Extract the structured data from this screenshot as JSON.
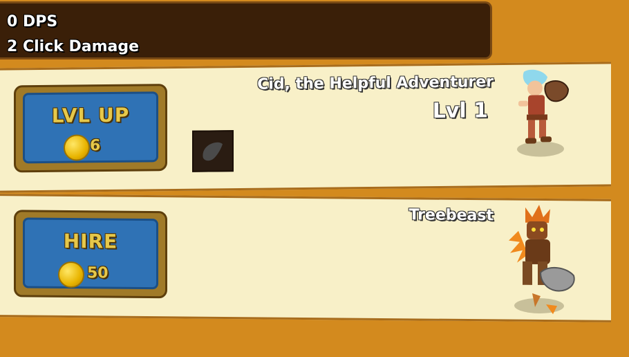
{
  "stats": {
    "dps": "0 DPS",
    "click_damage": "2 Click Damage"
  },
  "heroes": [
    {
      "name": "Cid, the Helpful Adventurer",
      "level": "Lvl 1",
      "button_label": "LVL UP",
      "cost": "6",
      "portrait_icon": "cid-hero-icon",
      "upgrade_icon": "locked-upgrade-icon"
    },
    {
      "name": "Treebeast",
      "button_label": "HIRE",
      "cost": "50",
      "portrait_icon": "treebeast-hero-icon"
    }
  ],
  "colors": {
    "background": "#d38a1e",
    "row": "#f8f0c8",
    "button_blue": "#2f72b5",
    "button_text": "#e6c84a"
  }
}
